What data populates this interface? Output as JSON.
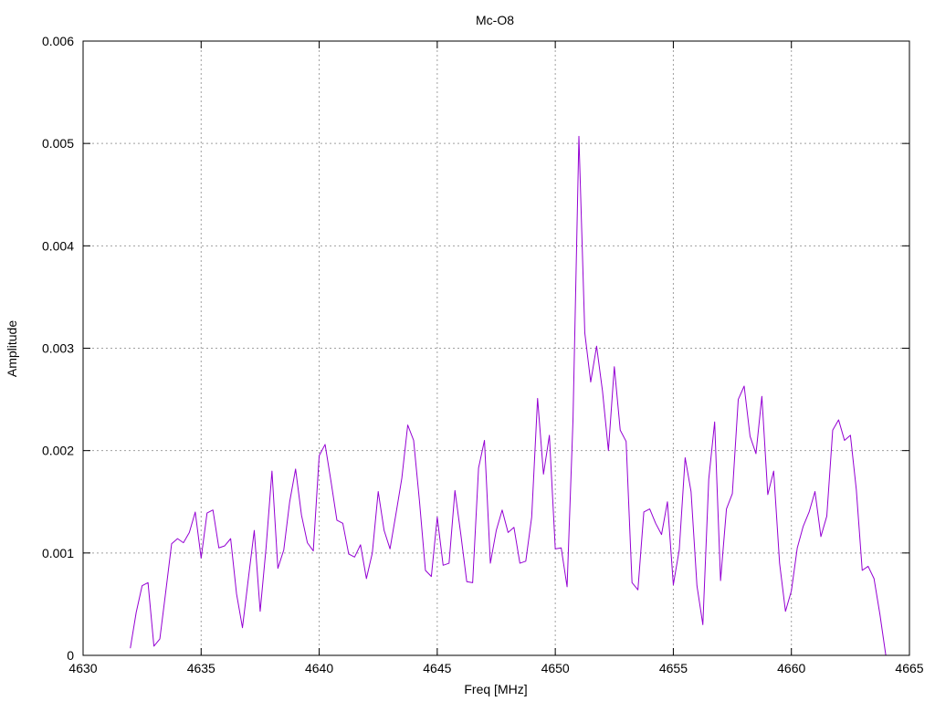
{
  "chart_data": {
    "type": "line",
    "title": "Mc-O8",
    "xlabel": "Freq [MHz]",
    "ylabel": "Amplitude",
    "xlim": [
      4630,
      4665
    ],
    "ylim": [
      0,
      0.006
    ],
    "x_ticks": [
      "4630",
      "4635",
      "4640",
      "4645",
      "4650",
      "4655",
      "4660",
      "4665"
    ],
    "y_ticks": [
      "0",
      "0.001",
      "0.002",
      "0.003",
      "0.004",
      "0.005",
      "0.006"
    ],
    "grid": true,
    "legend": "none",
    "series": [
      {
        "color": "#9400d3",
        "x": [
          4632.0,
          4632.25,
          4632.5,
          4632.75,
          4633.0,
          4633.25,
          4633.5,
          4633.75,
          4634.0,
          4634.25,
          4634.5,
          4634.75,
          4635.0,
          4635.25,
          4635.5,
          4635.75,
          4636.0,
          4636.25,
          4636.5,
          4636.75,
          4637.0,
          4637.25,
          4637.5,
          4637.75,
          4638.0,
          4638.25,
          4638.5,
          4638.75,
          4639.0,
          4639.25,
          4639.5,
          4639.75,
          4640.0,
          4640.25,
          4640.5,
          4640.75,
          4641.0,
          4641.25,
          4641.5,
          4641.75,
          4642.0,
          4642.25,
          4642.5,
          4642.75,
          4643.0,
          4643.25,
          4643.5,
          4643.75,
          4644.0,
          4644.25,
          4644.5,
          4644.75,
          4645.0,
          4645.25,
          4645.5,
          4645.75,
          4646.0,
          4646.25,
          4646.5,
          4646.75,
          4647.0,
          4647.25,
          4647.5,
          4647.75,
          4648.0,
          4648.25,
          4648.5,
          4648.75,
          4649.0,
          4649.25,
          4649.5,
          4649.75,
          4650.0,
          4650.25,
          4650.5,
          4650.75,
          4651.0,
          4651.25,
          4651.5,
          4651.75,
          4652.0,
          4652.25,
          4652.5,
          4652.75,
          4653.0,
          4653.25,
          4653.5,
          4653.75,
          4654.0,
          4654.25,
          4654.5,
          4654.75,
          4655.0,
          4655.25,
          4655.5,
          4655.75,
          4656.0,
          4656.25,
          4656.5,
          4656.75,
          4657.0,
          4657.25,
          4657.5,
          4657.75,
          4658.0,
          4658.25,
          4658.5,
          4658.75,
          4659.0,
          4659.25,
          4659.5,
          4659.75,
          4660.0,
          4660.25,
          4660.5,
          4660.75,
          4661.0,
          4661.25,
          4661.5,
          4661.75,
          4662.0,
          4662.25,
          4662.5,
          4662.75,
          4663.0,
          4663.25,
          4663.5,
          4663.75,
          4664.0
        ],
        "y": [
          7e-05,
          0.00042,
          0.00068,
          0.00071,
          9e-05,
          0.00016,
          0.00062,
          0.00109,
          0.00114,
          0.0011,
          0.0012,
          0.0014,
          0.00095,
          0.00139,
          0.00142,
          0.00105,
          0.00107,
          0.00114,
          0.0006,
          0.00027,
          0.00075,
          0.00122,
          0.00043,
          0.00105,
          0.0018,
          0.00085,
          0.00103,
          0.0015,
          0.00182,
          0.00137,
          0.0011,
          0.00102,
          0.00195,
          0.00206,
          0.0017,
          0.00132,
          0.00129,
          0.00099,
          0.00096,
          0.00108,
          0.00075,
          0.001,
          0.0016,
          0.00122,
          0.00104,
          0.00138,
          0.00173,
          0.00225,
          0.0021,
          0.0015,
          0.00083,
          0.00077,
          0.00135,
          0.00088,
          0.0009,
          0.00161,
          0.00118,
          0.00072,
          0.00071,
          0.00183,
          0.0021,
          0.0009,
          0.00122,
          0.00142,
          0.0012,
          0.00125,
          0.0009,
          0.00092,
          0.00135,
          0.00251,
          0.00177,
          0.00215,
          0.00104,
          0.00105,
          0.00067,
          0.0023,
          0.00507,
          0.00315,
          0.00267,
          0.00302,
          0.00258,
          0.002,
          0.00282,
          0.0022,
          0.00209,
          0.00071,
          0.00064,
          0.0014,
          0.00143,
          0.00129,
          0.00118,
          0.0015,
          0.00069,
          0.00103,
          0.00193,
          0.0016,
          0.00068,
          0.0003,
          0.00172,
          0.00228,
          0.00073,
          0.00143,
          0.00158,
          0.0025,
          0.00263,
          0.00214,
          0.00197,
          0.00253,
          0.00157,
          0.0018,
          0.0009,
          0.00043,
          0.00063,
          0.00105,
          0.00126,
          0.0014,
          0.0016,
          0.00116,
          0.00136,
          0.0022,
          0.0023,
          0.0021,
          0.00215,
          0.00162,
          0.00083,
          0.00087,
          0.00075,
          0.0004,
          0.0
        ]
      }
    ]
  }
}
